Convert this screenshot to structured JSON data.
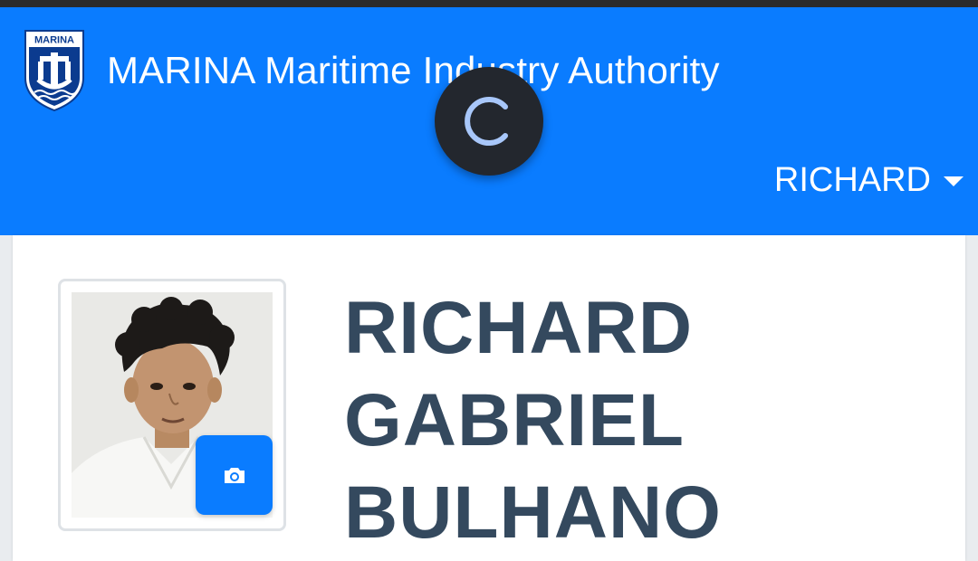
{
  "navbar": {
    "logo_text": "MARINA",
    "title": "MARINA Maritime Industry Authority",
    "user_menu_label": "RICHARD"
  },
  "loader": {
    "icon": "loading-spinner-icon"
  },
  "profile": {
    "name_lines": [
      "RICHARD",
      "GABRIEL",
      "BULHANO"
    ],
    "photo_icon": "camera-icon"
  },
  "colors": {
    "primary": "#0a7cff",
    "name_text": "#34495e",
    "loader_bg": "#23272e",
    "loader_accent": "#a8c7fa"
  }
}
